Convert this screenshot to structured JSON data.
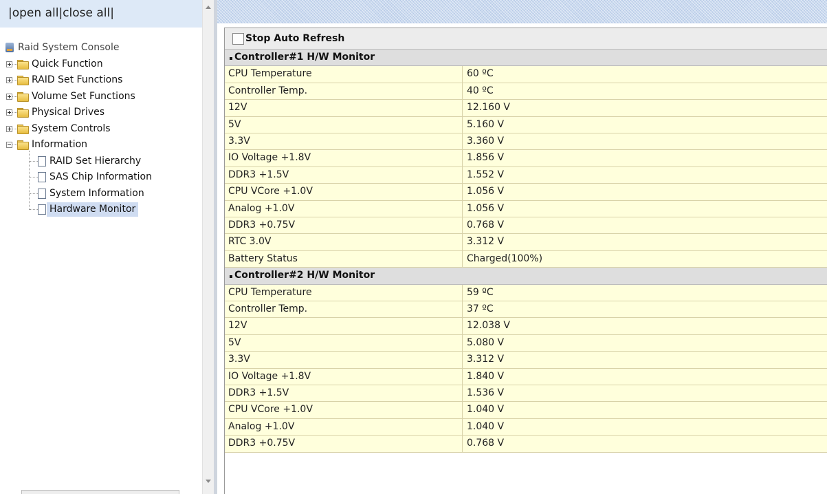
{
  "tree_header": {
    "open_all": "open all",
    "close_all": "close all",
    "sep": "|"
  },
  "tree": {
    "root": "Raid System Console",
    "folders": [
      "Quick Function",
      "RAID Set Functions",
      "Volume Set Functions",
      "Physical Drives",
      "System Controls",
      "Information"
    ],
    "leaves": [
      "RAID Set Hierarchy",
      "SAS Chip Information",
      "System Information",
      "Hardware Monitor"
    ],
    "selected": "Hardware Monitor"
  },
  "content": {
    "stop_auto_refresh": "Stop Auto Refresh",
    "stop_auto_refresh_checked": false,
    "controller1": {
      "title": "Controller#1 H/W Monitor",
      "rows": [
        [
          "CPU Temperature",
          "60 ºC"
        ],
        [
          "Controller Temp.",
          "40 ºC"
        ],
        [
          "12V",
          "12.160 V"
        ],
        [
          "5V",
          "5.160 V"
        ],
        [
          "3.3V",
          "3.360 V"
        ],
        [
          "IO Voltage +1.8V",
          "1.856 V"
        ],
        [
          "DDR3 +1.5V",
          "1.552 V"
        ],
        [
          "CPU VCore +1.0V",
          "1.056 V"
        ],
        [
          "Analog +1.0V",
          "1.056 V"
        ],
        [
          "DDR3 +0.75V",
          "0.768 V"
        ],
        [
          "RTC 3.0V",
          "3.312 V"
        ],
        [
          "Battery Status",
          "Charged(100%)"
        ]
      ]
    },
    "controller2": {
      "title": "Controller#2 H/W Monitor",
      "rows": [
        [
          "CPU Temperature",
          "59 ºC"
        ],
        [
          "Controller Temp.",
          "37 ºC"
        ],
        [
          "12V",
          "12.038 V"
        ],
        [
          "5V",
          "5.080 V"
        ],
        [
          "3.3V",
          "3.312 V"
        ],
        [
          "IO Voltage +1.8V",
          "1.840 V"
        ],
        [
          "DDR3 +1.5V",
          "1.536 V"
        ],
        [
          "CPU VCore +1.0V",
          "1.040 V"
        ],
        [
          "Analog +1.0V",
          "1.040 V"
        ],
        [
          "DDR3 +0.75V",
          "0.768 V"
        ]
      ]
    }
  },
  "icons": {
    "root": "server-icon",
    "folder": "folder-icon",
    "leaf": "document-icon",
    "expand": "plus-expander-icon",
    "collapse": "minus-expander-icon"
  }
}
